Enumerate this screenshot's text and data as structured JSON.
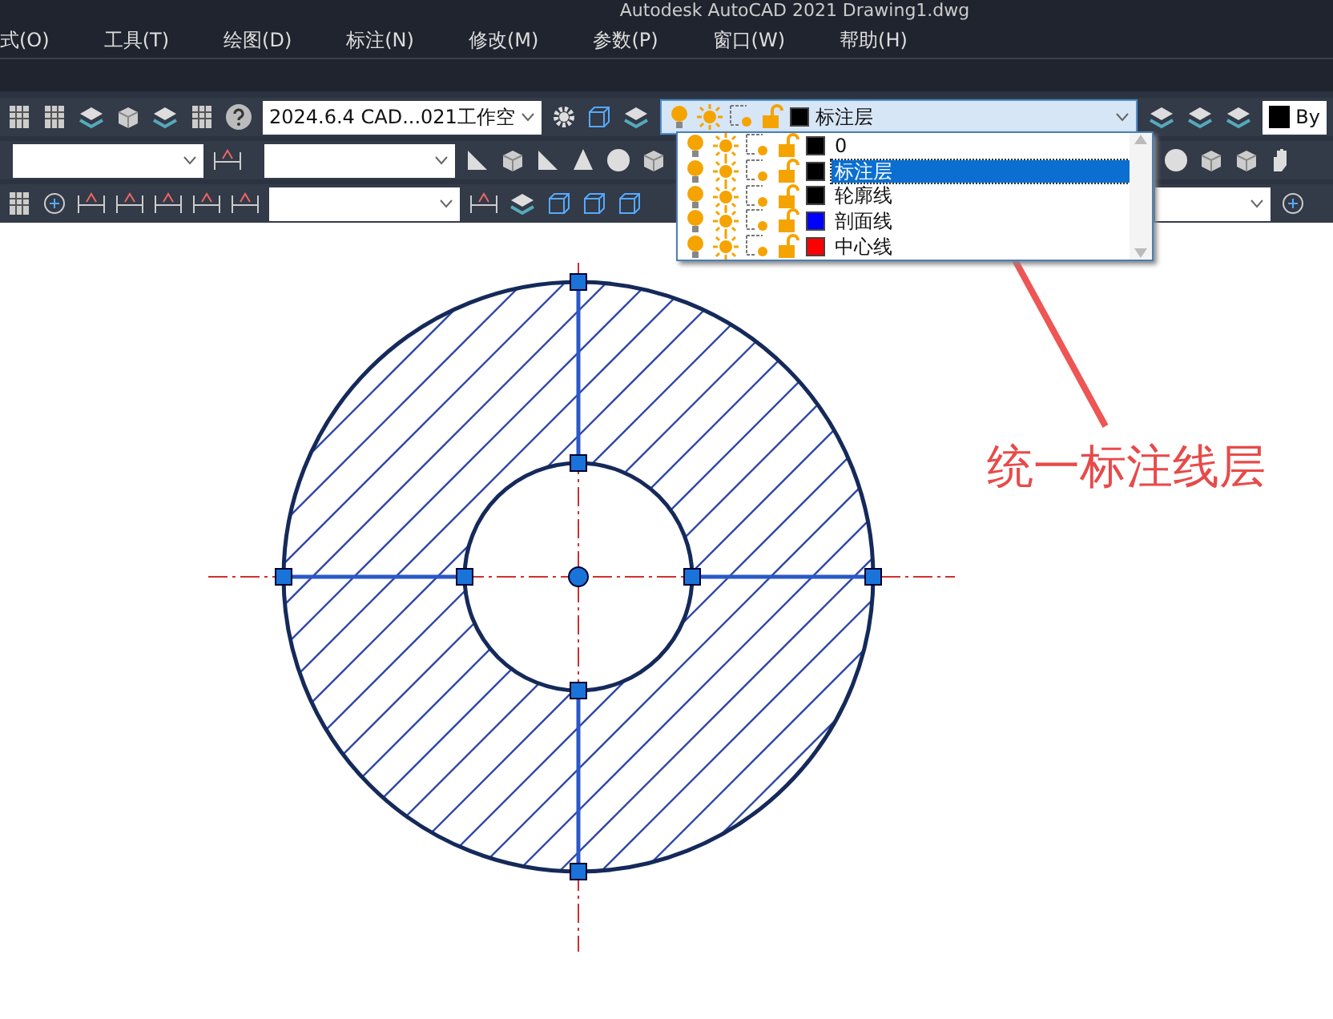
{
  "window": {
    "title": "Autodesk AutoCAD 2021    Drawing1.dwg"
  },
  "menu": [
    "式(O)",
    "工具(T)",
    "绘图(D)",
    "标注(N)",
    "修改(M)",
    "参数(P)",
    "窗口(W)",
    "帮助(H)"
  ],
  "workspace": {
    "value": "2024.6.4 CAD...021工作空"
  },
  "color_control": {
    "value": "By"
  },
  "layer_dropdown": {
    "current": {
      "name": "标注层",
      "color": "#000000"
    },
    "layers": [
      {
        "name": "0",
        "color": "#000000",
        "selected": false
      },
      {
        "name": "标注层",
        "color": "#000000",
        "selected": true
      },
      {
        "name": "轮廓线",
        "color": "#000000",
        "selected": false
      },
      {
        "name": "剖面线",
        "color": "#0000ff",
        "selected": false
      },
      {
        "name": "中心线",
        "color": "#ff0000",
        "selected": false
      }
    ]
  },
  "annotation": {
    "text": "统一标注线层"
  }
}
